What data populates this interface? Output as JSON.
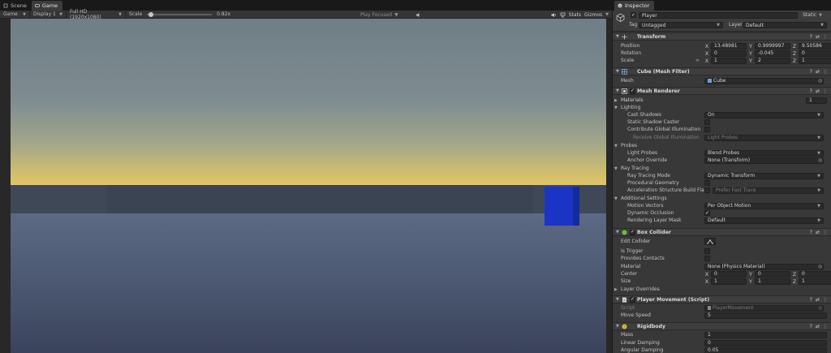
{
  "left_tabs": [
    {
      "label": "Scene",
      "icon": "scene-icon"
    },
    {
      "label": "Game",
      "icon": "game-icon"
    }
  ],
  "game_toolbar": {
    "mode": "Game",
    "display": "Display 1",
    "resolution": "Full HD (1920x1080)",
    "scale_label": "Scale",
    "scale_value": "0.82x",
    "scale_fraction": 0.02,
    "play_focused": "Play Focused",
    "stats": "Stats",
    "gizmos": "Gizmos"
  },
  "inspector": {
    "tab_label": "Inspector",
    "object_name": "Player",
    "static_label": "Static",
    "tag_label": "Tag",
    "tag_value": "Untagged",
    "layer_label": "Layer",
    "layer_value": "Default",
    "transform": {
      "title": "Transform",
      "position_label": "Position",
      "position": {
        "x": "13.48981",
        "y": "0.9999997",
        "z": "9.50586"
      },
      "rotation_label": "Rotation",
      "rotation": {
        "x": "0",
        "y": "-0.045",
        "z": "0"
      },
      "scale_label": "Scale",
      "scale": {
        "x": "1",
        "y": "2",
        "z": "1"
      }
    },
    "mesh_filter": {
      "title": "Cube (Mesh Filter)",
      "mesh_label": "Mesh",
      "mesh_value": "Cube"
    },
    "mesh_renderer": {
      "title": "Mesh Renderer",
      "materials_label": "Materials",
      "materials_count": "1",
      "lighting_label": "Lighting",
      "cast_shadows_label": "Cast Shadows",
      "cast_shadows_value": "On",
      "static_shadow_label": "Static Shadow Caster",
      "contribute_gi_label": "Contribute Global Illumination",
      "receive_gi_label": "Receive Global Illumination",
      "receive_gi_value": "Light Probes",
      "probes_label": "Probes",
      "light_probes_label": "Light Probes",
      "light_probes_value": "Blend Probes",
      "anchor_override_label": "Anchor Override",
      "anchor_override_value": "None (Transform)",
      "ray_tracing_label": "Ray Tracing",
      "ray_tracing_mode_label": "Ray Tracing Mode",
      "ray_tracing_mode_value": "Dynamic Transform",
      "procedural_geometry_label": "Procedural Geometry",
      "accel_label": "Acceleration Structure Build Flags",
      "accel_value": "Prefer Fast Trace",
      "additional_label": "Additional Settings",
      "motion_vectors_label": "Motion Vectors",
      "motion_vectors_value": "Per Object Motion",
      "dynamic_occlusion_label": "Dynamic Occlusion",
      "rendering_layer_label": "Rendering Layer Mask",
      "rendering_layer_value": "Default"
    },
    "box_collider": {
      "title": "Box Collider",
      "edit_collider_label": "Edit Collider",
      "is_trigger_label": "Is Trigger",
      "provides_contacts_label": "Provides Contacts",
      "material_label": "Material",
      "material_value": "None (Physics Material)",
      "center_label": "Center",
      "center": {
        "x": "0",
        "y": "0",
        "z": "0"
      },
      "size_label": "Size",
      "size": {
        "x": "1",
        "y": "1",
        "z": "1"
      },
      "layer_overrides_label": "Layer Overrides"
    },
    "player_movement": {
      "title": "Player Movement (Script)",
      "script_label": "Script",
      "script_value": "PlayerMovement",
      "move_speed_label": "Move Speed",
      "move_speed_value": "5"
    },
    "rigidbody": {
      "title": "Rigidbody",
      "mass_label": "Mass",
      "mass_value": "1",
      "linear_damping_label": "Linear Damping",
      "linear_damping_value": "0",
      "angular_damping_label": "Angular Damping",
      "angular_damping_value": "0.05"
    }
  },
  "axes": {
    "x": "X",
    "y": "Y",
    "z": "Z"
  },
  "colors": {
    "cube": "#1c34c6",
    "horizon": "#e2c564",
    "accent_blue": "#3a79d9"
  }
}
